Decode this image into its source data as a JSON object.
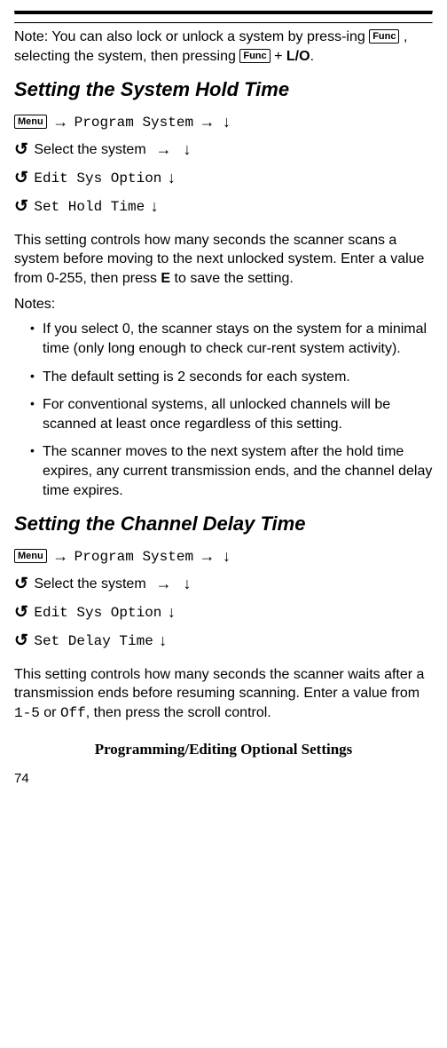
{
  "note_block": {
    "prefix": "Note: You can also lock or unlock a system by press-ing ",
    "key1": "Func",
    "mid1": ", selecting the system, then pressing ",
    "key2": "Func",
    "mid2": " + ",
    "bold_end": "L/O",
    "suffix": "."
  },
  "section1": {
    "heading": "Setting the System Hold Time",
    "menu_key": "Menu",
    "path_program": "Program System",
    "path_select": "Select the system",
    "path_edit": "Edit Sys Option",
    "path_final": "Set Hold Time",
    "body": "This setting controls how many seconds the scanner scans a system before moving to the next unlocked system. Enter a value from 0-255, then press ",
    "body_bold": "E",
    "body_suffix": " to save the setting.",
    "notes_label": "Notes:",
    "bullets": [
      "If you select 0, the scanner stays on the system for a minimal time (only long enough to check cur-rent system activity).",
      "The default setting is 2 seconds for each system.",
      "For conventional systems, all unlocked channels will be scanned at least once regardless of this setting.",
      "The scanner moves to the next system after the hold time expires, any current transmission ends, and the channel delay time expires."
    ]
  },
  "section2": {
    "heading": "Setting the Channel Delay Time",
    "menu_key": "Menu",
    "path_program": "Program System",
    "path_select": "Select the system",
    "path_edit": "Edit Sys Option",
    "path_final": "Set Delay Time",
    "body_prefix": "This setting controls how many seconds the scanner waits after a transmission ends before resuming scanning. Enter a value from ",
    "body_mono1": "1-5",
    "body_mid": " or ",
    "body_mono2": "Off",
    "body_suffix": ", then press the scroll control."
  },
  "footer_title": "Programming/Editing Optional Settings",
  "page_number": "74"
}
